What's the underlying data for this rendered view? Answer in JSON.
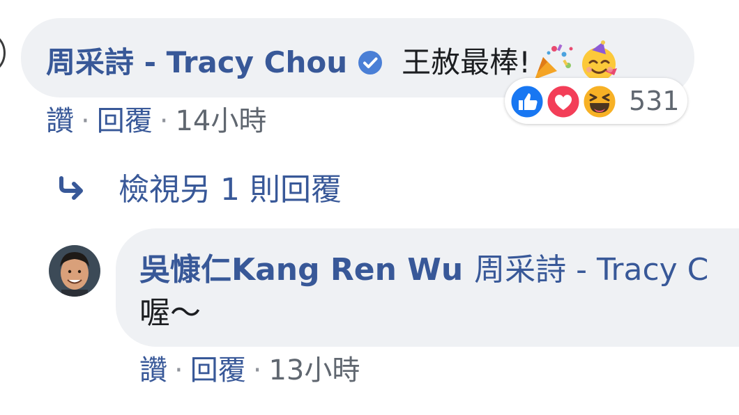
{
  "comment": {
    "author": "周采詩 - Tracy Chou",
    "verified": true,
    "text": "王赦最棒!",
    "emojis": [
      "party-popper-icon",
      "partying-face-icon"
    ],
    "reactions": {
      "types": [
        "like",
        "love",
        "haha"
      ],
      "count": "531"
    },
    "actions": {
      "like_label": "讚",
      "reply_label": "回覆",
      "separator": "·",
      "time": "14小時"
    }
  },
  "view_more": {
    "label": "檢視另 1 則回覆"
  },
  "reply": {
    "author": "吳慷仁Kang Ren Wu",
    "mention": "周采詩 - Tracy C",
    "text": "喔～",
    "actions": {
      "like_label": "讚",
      "reply_label": "回覆",
      "separator": "·",
      "time": "13小時"
    }
  },
  "colors": {
    "link_blue": "#385898",
    "bubble_bg": "#eff1f4",
    "text": "#1c1e21",
    "meta_gray": "#606770",
    "like_blue": "#1877f2",
    "love_red": "#f33e58",
    "haha_yellow": "#f7b125"
  }
}
